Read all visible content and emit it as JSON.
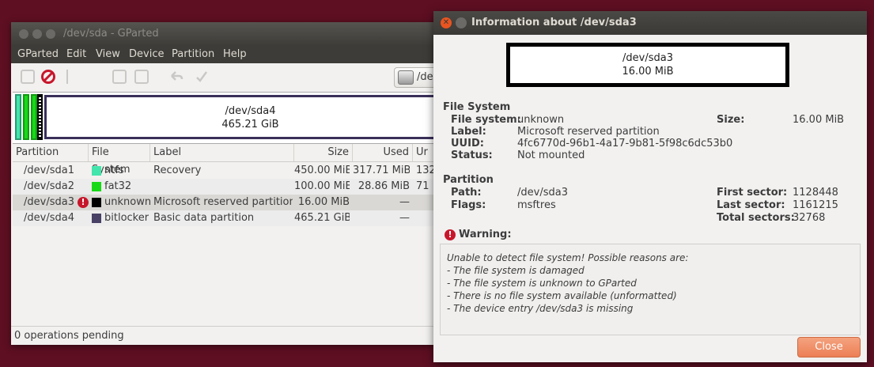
{
  "main_window": {
    "title": "/dev/sda - GParted",
    "menu": [
      "GParted",
      "Edit",
      "View",
      "Device",
      "Partition",
      "Help"
    ],
    "device_selector": "/de",
    "disk_map": {
      "name": "/dev/sda4",
      "size": "465.21 GiB"
    },
    "columns": [
      "Partition",
      "File System",
      "Label",
      "Size",
      "Used",
      "Ur"
    ],
    "rows": [
      {
        "partition": "/dev/sda1",
        "fs": "ntfs",
        "fs_color": "#42e5ac",
        "label": "Recovery",
        "size": "450.00 MiB",
        "used": "317.71 MiB",
        "unused": "132",
        "warning": false
      },
      {
        "partition": "/dev/sda2",
        "fs": "fat32",
        "fs_color": "#18d918",
        "label": "",
        "size": "100.00 MiB",
        "used": "28.86 MiB",
        "unused": "71",
        "warning": false
      },
      {
        "partition": "/dev/sda3",
        "fs": "unknown",
        "fs_color": "#000000",
        "label": "Microsoft reserved partition",
        "size": "16.00 MiB",
        "used": "—",
        "unused": "",
        "warning": true
      },
      {
        "partition": "/dev/sda4",
        "fs": "bitlocker",
        "fs_color": "#494066",
        "label": "Basic data partition",
        "size": "465.21 GiB",
        "used": "—",
        "unused": "",
        "warning": false
      }
    ],
    "status": "0 operations pending"
  },
  "dialog": {
    "title": "Information about /dev/sda3",
    "map": {
      "name": "/dev/sda3",
      "size": "16.00 MiB"
    },
    "file_system_heading": "File System",
    "fs_labels": {
      "file_system": "File system:",
      "label": "Label:",
      "uuid": "UUID:",
      "status": "Status:",
      "size": "Size:"
    },
    "fs_values": {
      "file_system": "unknown",
      "label": "Microsoft reserved partition",
      "uuid": "4fc6770d-96b1-4a17-9b81-5f98c6dc53b0",
      "status": "Not mounted",
      "size": "16.00 MiB"
    },
    "partition_heading": "Partition",
    "part_labels": {
      "path": "Path:",
      "flags": "Flags:",
      "first_sector": "First sector:",
      "last_sector": "Last sector:",
      "total_sectors": "Total sectors:"
    },
    "part_values": {
      "path": "/dev/sda3",
      "flags": "msftres",
      "first_sector": "1128448",
      "last_sector": "1161215",
      "total_sectors": "32768"
    },
    "warning_heading": "Warning:",
    "warning_lines": [
      "Unable to detect file system! Possible reasons are:",
      "- The file system is damaged",
      "- The file system is unknown to GParted",
      "- There is no file system available (unformatted)",
      "- The device entry /dev/sda3 is missing"
    ],
    "close_label": "Close"
  },
  "colors": {
    "desktop": "#5e0f22",
    "accent": "#e95420",
    "error": "#c7162b"
  }
}
